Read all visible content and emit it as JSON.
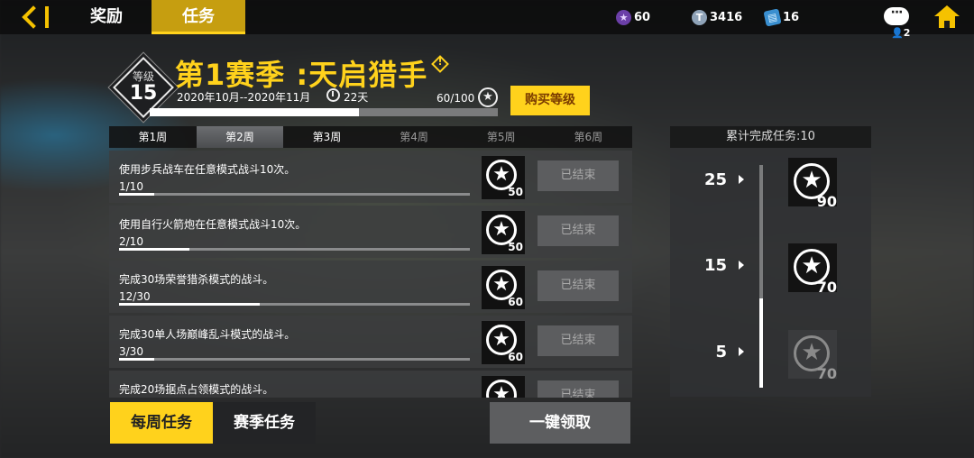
{
  "topbar": {
    "tabs": {
      "reward": "奖励",
      "tasks": "任务"
    },
    "resources": {
      "star_points": "60",
      "coins": "3416",
      "cards": "16"
    },
    "chat_count": "2"
  },
  "season": {
    "level_label": "等级",
    "level": "15",
    "title": "第1赛季 :天启猎手",
    "date_range": "2020年10月--2020年11月",
    "days_left": "22天",
    "xp_text": "60/100",
    "xp_progress": 0.6,
    "buy_button": "购买等级"
  },
  "weeks": [
    {
      "label": "第1周",
      "state": "normal"
    },
    {
      "label": "第2周",
      "state": "active"
    },
    {
      "label": "第3周",
      "state": "normal"
    },
    {
      "label": "第4周",
      "state": "dim"
    },
    {
      "label": "第5周",
      "state": "dim"
    },
    {
      "label": "第6周",
      "state": "dim"
    }
  ],
  "tasks": [
    {
      "desc": "使用步兵战车在任意模式战斗10次。",
      "progress": "1/10",
      "fraction": 0.1,
      "reward": "50",
      "status": "已结束"
    },
    {
      "desc": "使用自行火箭炮在任意模式战斗10次。",
      "progress": "2/10",
      "fraction": 0.2,
      "reward": "50",
      "status": "已结束"
    },
    {
      "desc": "完成30场荣誉猎杀模式的战斗。",
      "progress": "12/30",
      "fraction": 0.4,
      "reward": "60",
      "status": "已结束"
    },
    {
      "desc": "完成30单人场巅峰乱斗模式的战斗。",
      "progress": "3/30",
      "fraction": 0.1,
      "reward": "60",
      "status": "已结束"
    },
    {
      "desc": "完成20场据点占领模式的战斗。",
      "progress": "",
      "fraction": 0,
      "reward": "",
      "status": "已结束"
    }
  ],
  "bottom": {
    "weekly": "每周任务",
    "season": "赛季任务",
    "claim": "一键领取"
  },
  "cumulative": {
    "header": "累计完成任务:10",
    "completed": 10,
    "max": 25,
    "milestones": [
      {
        "count": "25",
        "reward": "90",
        "state": "normal"
      },
      {
        "count": "15",
        "reward": "70",
        "state": "normal"
      },
      {
        "count": "5",
        "reward": "70",
        "state": "dim"
      }
    ]
  },
  "icons": {
    "back": "back-arrow-icon",
    "star": "star-icon",
    "coin": "coin-icon",
    "card": "card-icon",
    "chat": "chat-icon",
    "home": "home-icon",
    "clock": "clock-icon",
    "warning": "warning-icon"
  },
  "colors": {
    "accent": "#ffd21c",
    "tab_active": "#c69e10",
    "status_bg": "#5c5d5f"
  }
}
